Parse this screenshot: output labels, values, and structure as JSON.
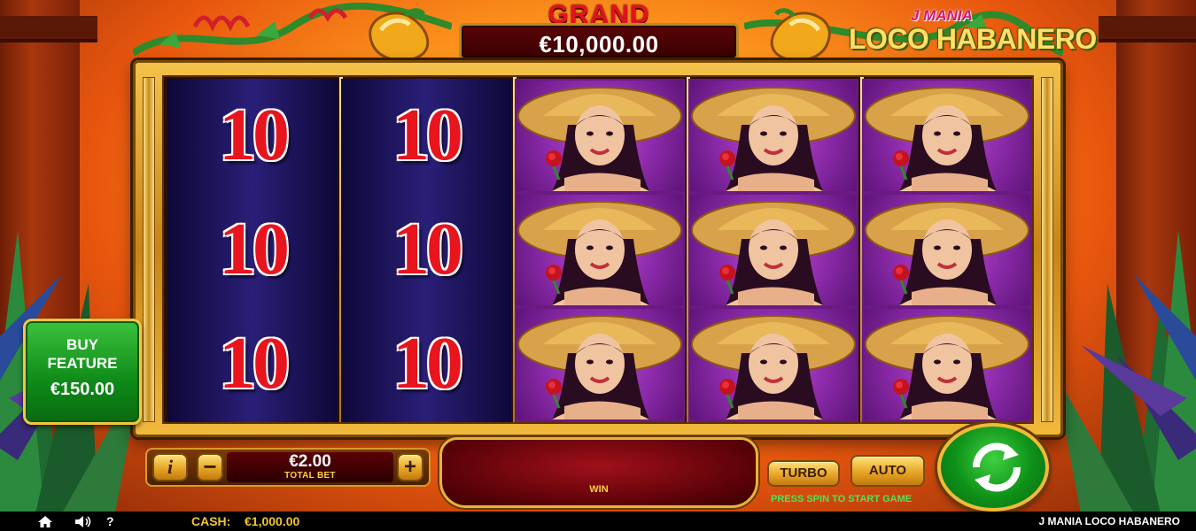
{
  "jackpot": {
    "title": "GRAND",
    "value": "€10,000.00"
  },
  "logo": {
    "mania": "J MANIA",
    "name": "LOCO HABANERO"
  },
  "reels": [
    {
      "symbols": [
        "10",
        "10",
        "10"
      ]
    },
    {
      "symbols": [
        "10",
        "10",
        "10"
      ]
    },
    {
      "symbols": [
        "senorita",
        "senorita",
        "senorita"
      ]
    },
    {
      "symbols": [
        "senorita",
        "senorita",
        "senorita"
      ]
    },
    {
      "symbols": [
        "senorita",
        "senorita",
        "senorita"
      ]
    }
  ],
  "buy_feature": {
    "label_line1": "BUY",
    "label_line2": "FEATURE",
    "price": "€150.00"
  },
  "bet": {
    "value": "€2.00",
    "label": "TOTAL BET",
    "info": "i",
    "minus": "−",
    "plus": "+"
  },
  "win": {
    "label": "WIN"
  },
  "controls": {
    "turbo": "TURBO",
    "auto": "AUTO",
    "hint": "PRESS SPIN TO START GAME"
  },
  "status": {
    "cash_label": "CASH:",
    "cash_value": "€1,000.00",
    "game_title": "J MANIA LOCO HABANERO",
    "help": "?"
  },
  "icons": [
    "home-icon",
    "speaker-icon",
    "help-icon",
    "spin-arrows-icon"
  ],
  "colors": {
    "jackpot_red": "#e3121e",
    "gold": "#f2c534",
    "green": "#0e8a18",
    "purple": "#8a2aa8",
    "blue": "#2a1f78"
  }
}
